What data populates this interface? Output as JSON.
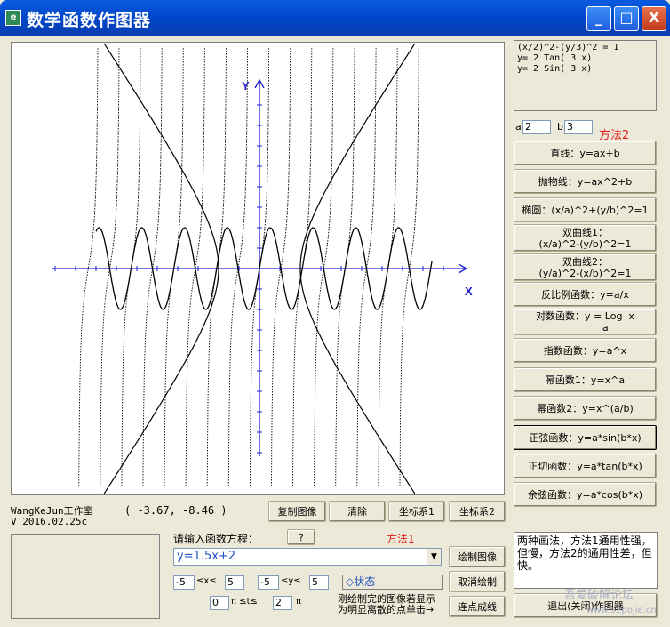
{
  "window": {
    "title": "数学函数作图器",
    "icon_name": "app-icon",
    "minimize_label": "_",
    "maximize_label": "□",
    "close_label": "X"
  },
  "info_lines": "(x/2)^2-(y/3)^2 = 1\ny= 2 Tan( 3 x)\ny= 2 Sin( 3 x)",
  "params": {
    "a_label": "a",
    "a_value": "2",
    "b_label": "b",
    "b_value": "3",
    "method2_label": "方法2"
  },
  "function_buttons": [
    {
      "label": "直线：y=ax+b"
    },
    {
      "label": "抛物线：y=ax^2+b"
    },
    {
      "label": "椭圆：(x/a)^2+(y/b)^2=1"
    },
    {
      "label": "双曲线1：\n(x/a)^2-(y/b)^2=1"
    },
    {
      "label": "双曲线2：\n(y/a)^2-(x/b)^2=1"
    },
    {
      "label": "反比例函数：y=a/x"
    },
    {
      "label": "对数函数：y = Log  x\n             a"
    },
    {
      "label": "指数函数：y=a^x"
    },
    {
      "label": "幂函数1：y=x^a"
    },
    {
      "label": "幂函数2：y=x^(a/b)"
    },
    {
      "label": "正弦函数：y=a*sin(b*x)"
    },
    {
      "label": "正切函数：y=a*tan(b*x)"
    },
    {
      "label": "余弦函数：y=a*cos(b*x)"
    }
  ],
  "chart_data": {
    "type": "line",
    "xlabel": "X",
    "ylabel": "Y",
    "series": [
      {
        "formula": "(x/2)^2-(y/3)^2 = 1",
        "a": 2,
        "b": 3,
        "kind": "hyperbola"
      },
      {
        "formula": "y= 2 Tan( 3 x)",
        "a": 2,
        "b": 3,
        "kind": "tan"
      },
      {
        "formula": "y= 2 Sin( 3 x)",
        "a": 2,
        "b": 3,
        "kind": "sin"
      }
    ],
    "line_color": "#000000",
    "axis_color": "#2020D0"
  },
  "author": "WangKeJun工作室",
  "version": "V 2016.02.25c",
  "coords": "( -3.67, -8.46 )",
  "top_buttons": {
    "copy": "复制图像",
    "clear": "清除",
    "axes1": "坐标系1",
    "axes2": "坐标系2"
  },
  "input": {
    "prompt": "请输入函数方程：",
    "help": "?",
    "method1_label": "方法1",
    "equation": "y=1.5x+2"
  },
  "range": {
    "x_min": "-5",
    "x_label": "≤x≤",
    "x_max": "5",
    "y_min": "-5",
    "y_label": "≤y≤",
    "y_max": "5",
    "t_min": "0",
    "t_label": "π ≤t≤",
    "t_max": "2",
    "t_unit": "π"
  },
  "status": "◇状态",
  "actions": {
    "draw": "绘制图像",
    "cancel": "取消绘制",
    "connect": "连点成线",
    "exit": "退出(关闭)作图器"
  },
  "hint": "刚绘制完的图像若显示\n为明显离散的点单击→",
  "note": "两种画法，方法1通用性强，但慢，方法2的通用性差，但快。",
  "watermark": "吾爱破解论坛",
  "watermark_url": "www.52pojie.cn"
}
